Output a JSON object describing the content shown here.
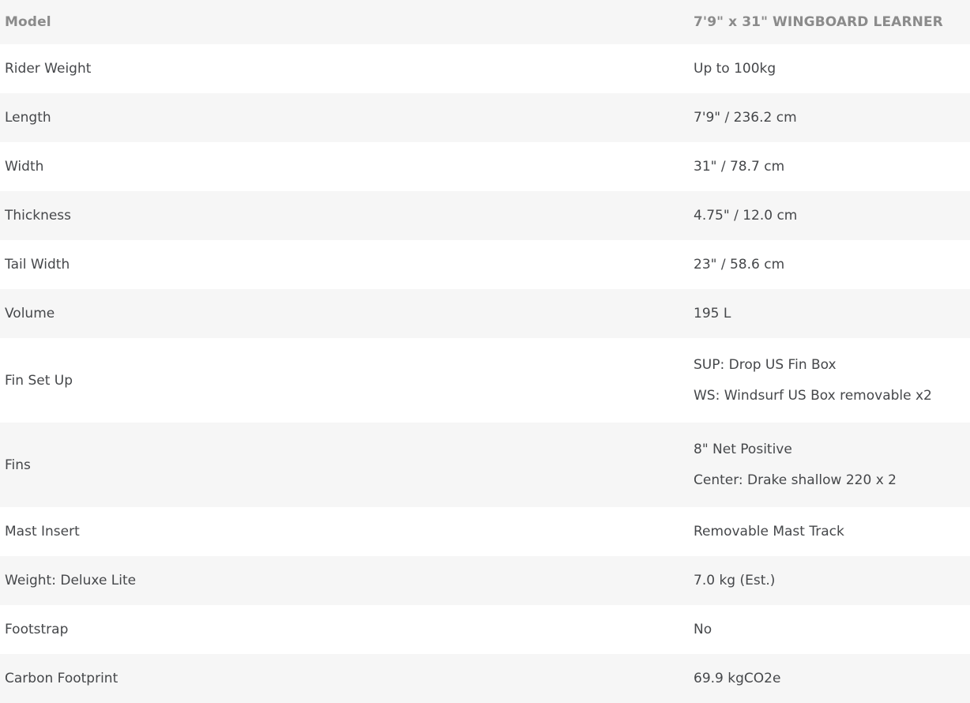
{
  "table": {
    "header": {
      "label": "Model",
      "value": "7'9\" x 31\" WINGBOARD LEARNER"
    },
    "rows": [
      {
        "label": "Rider Weight",
        "value": "Up to 100kg"
      },
      {
        "label": "Length",
        "value": "7'9\" / 236.2 cm"
      },
      {
        "label": "Width",
        "value": "31\" / 78.7 cm"
      },
      {
        "label": "Thickness",
        "value": "4.75\" / 12.0 cm"
      },
      {
        "label": "Tail Width",
        "value": "23\" / 58.6 cm"
      },
      {
        "label": "Volume",
        "value": "195 L"
      },
      {
        "label": "Fin Set Up",
        "value_line1": "SUP: Drop US Fin Box",
        "value_line2": "WS: Windsurf US Box removable x2"
      },
      {
        "label": "Fins",
        "value_line1": "8\" Net Positive",
        "value_line2": "Center: Drake shallow 220 x 2"
      },
      {
        "label": "Mast Insert",
        "value": "Removable Mast Track"
      },
      {
        "label": "Weight: Deluxe Lite",
        "value": "7.0 kg (Est.)"
      },
      {
        "label": "Footstrap",
        "value": "No"
      },
      {
        "label": "Carbon Footprint",
        "value": "69.9 kgCO2e"
      }
    ]
  },
  "colors": {
    "stripe": "#f6f6f6",
    "base": "#ffffff",
    "header_text": "#8b8b8b",
    "body_text": "#45474a"
  }
}
